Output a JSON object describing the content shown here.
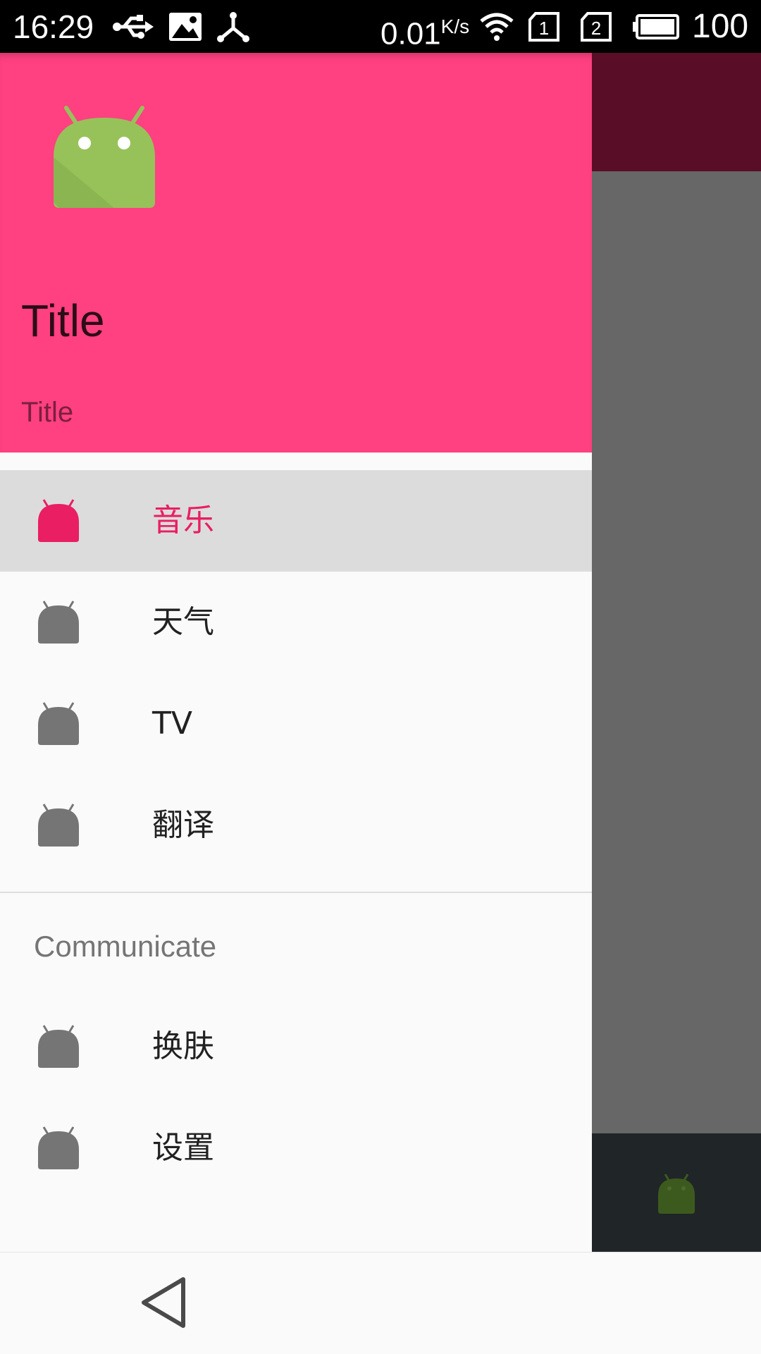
{
  "status_bar": {
    "time": "16:29",
    "net_rate": "0.01",
    "net_rate_unit": "K/s",
    "sim1": "1",
    "sim2": "2",
    "battery": "100",
    "icons": [
      "usb-icon",
      "image-icon",
      "share-icon",
      "wifi-icon",
      "sim1-icon",
      "sim2-icon",
      "battery-icon"
    ]
  },
  "drawer": {
    "header": {
      "title": "Title",
      "subtitle": "Title",
      "background": "#ff4081",
      "logo": "android-icon"
    },
    "items": [
      {
        "label": "音乐",
        "icon": "android-icon",
        "selected": true
      },
      {
        "label": "天气",
        "icon": "android-icon",
        "selected": false
      },
      {
        "label": "TV",
        "icon": "android-icon",
        "selected": false
      },
      {
        "label": "翻译",
        "icon": "android-icon",
        "selected": false
      }
    ],
    "section": {
      "title": "Communicate",
      "items": [
        {
          "label": "换肤",
          "icon": "android-icon"
        },
        {
          "label": "设置",
          "icon": "android-icon"
        }
      ]
    }
  },
  "colors": {
    "accent": "#e91e63",
    "icon_gray": "#757575",
    "android_green": "#97c25a"
  },
  "nav_bar": {
    "back": "back-icon"
  }
}
